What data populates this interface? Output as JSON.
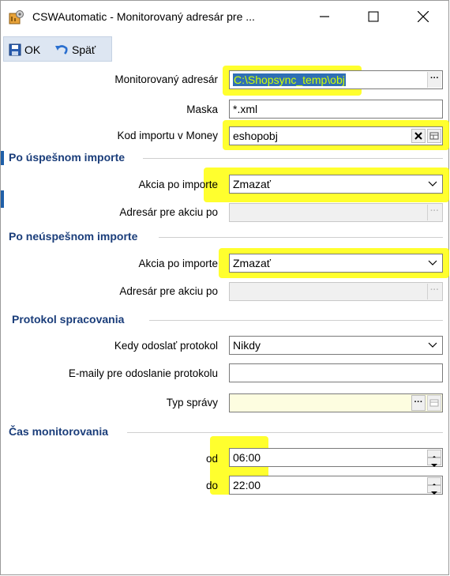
{
  "window": {
    "title": "CSWAutomatic - Monitorovaný adresár pre ..."
  },
  "toolbar": {
    "ok_label": "OK",
    "back_label": "Späť"
  },
  "form": {
    "monitor_dir_label": "Monitorovaný adresár",
    "monitor_dir_value": "C:\\Shopsync_temp\\obj",
    "mask_label": "Maska",
    "mask_value": "*.xml",
    "import_code_label": "Kod importu v Money",
    "import_code_value": "eshopobj"
  },
  "success": {
    "heading": "Po úspešnom importe",
    "action_label": "Akcia po importe",
    "action_value": "Zmazať",
    "dir_label": "Adresár pre akciu  po"
  },
  "failure": {
    "heading": "Po neúspešnom importe",
    "action_label": "Akcia po importe",
    "action_value": "Zmazať",
    "dir_label": "Adresár pre akciu  po"
  },
  "protocol": {
    "heading": "Protokol spracovania",
    "send_label": "Kedy odoslať protokol",
    "send_value": "Nikdy",
    "emails_label": "E-maily pre odoslanie protokolu",
    "emails_value": "",
    "msgtype_label": "Typ správy",
    "msgtype_value": ""
  },
  "time": {
    "heading": "Čas monitorovania",
    "from_label": "od",
    "from_value": "06:00",
    "to_label": "do",
    "to_value": "22:00"
  },
  "colors": {
    "highlight": "#ffff00",
    "section_heading": "#1a3d7a",
    "toolbar_bg": "#dde6f2"
  }
}
